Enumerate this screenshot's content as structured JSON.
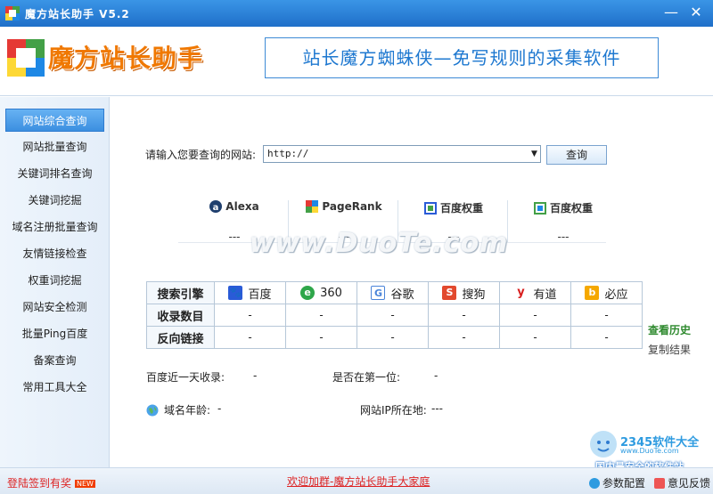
{
  "window": {
    "title": "魔方站长助手  V5.2",
    "minimize": "—",
    "close": "✕"
  },
  "header": {
    "logo_text": "魔方站长助手",
    "slogan": "站长魔方蜘蛛侠—免写规则的采集软件"
  },
  "sidebar": {
    "items": [
      {
        "label": "网站综合查询",
        "active": true
      },
      {
        "label": "网站批量查询"
      },
      {
        "label": "关键词排名查询"
      },
      {
        "label": "关键词挖掘"
      },
      {
        "label": "域名注册批量查询"
      },
      {
        "label": "友情链接检查"
      },
      {
        "label": "权重词挖掘"
      },
      {
        "label": "网站安全检测"
      },
      {
        "label": "批量Ping百度"
      },
      {
        "label": "备案查询"
      },
      {
        "label": "常用工具大全"
      }
    ]
  },
  "query": {
    "label": "请输入您要查询的网站:",
    "value": "http://",
    "button": "查询"
  },
  "ranks": [
    {
      "name": "Alexa",
      "value": "---"
    },
    {
      "name": "PageRank",
      "value": "---"
    },
    {
      "name": "百度权重",
      "value": "---"
    },
    {
      "name": "百度权重",
      "value": "---"
    }
  ],
  "table": {
    "header": "搜索引擎",
    "engines": [
      {
        "name": "百度",
        "glyph": "🐾",
        "color": "#2a5bd7"
      },
      {
        "name": "360",
        "glyph": "e",
        "color": "#2ea64a"
      },
      {
        "name": "谷歌",
        "glyph": "G",
        "color": "#4a84d9"
      },
      {
        "name": "搜狗",
        "glyph": "S",
        "color": "#e2492e"
      },
      {
        "name": "有道",
        "glyph": "y",
        "color": "#d81e1e"
      },
      {
        "name": "必应",
        "glyph": "b",
        "color": "#f5a800"
      }
    ],
    "rows": [
      {
        "label": "收录数目",
        "values": [
          "-",
          "-",
          "-",
          "-",
          "-",
          "-"
        ]
      },
      {
        "label": "反向链接",
        "values": [
          "-",
          "-",
          "-",
          "-",
          "-",
          "-"
        ]
      }
    ]
  },
  "side_links": {
    "history": "查看历史",
    "copy": "复制结果"
  },
  "info": {
    "baidu_recent_label": "百度近一天收录:",
    "baidu_recent_value": "-",
    "first_label": "是否在第一位:",
    "first_value": "-",
    "domain_age_label": "域名年龄:",
    "domain_age_value": "-",
    "ip_label": "网站IP所在地:",
    "ip_value": "---"
  },
  "watermark": "www.DuoTe.com",
  "statusbar": {
    "signin": "登陆签到有奖",
    "new_badge": "NEW",
    "group": "欢迎加群-魔方站长助手大家庭",
    "settings": "参数配置",
    "feedback": "意见反馈"
  },
  "corner_watermark": {
    "brand": "2345软件大全",
    "url": "www.DuoTe.com",
    "slogan": "国内最安全的软件站"
  }
}
